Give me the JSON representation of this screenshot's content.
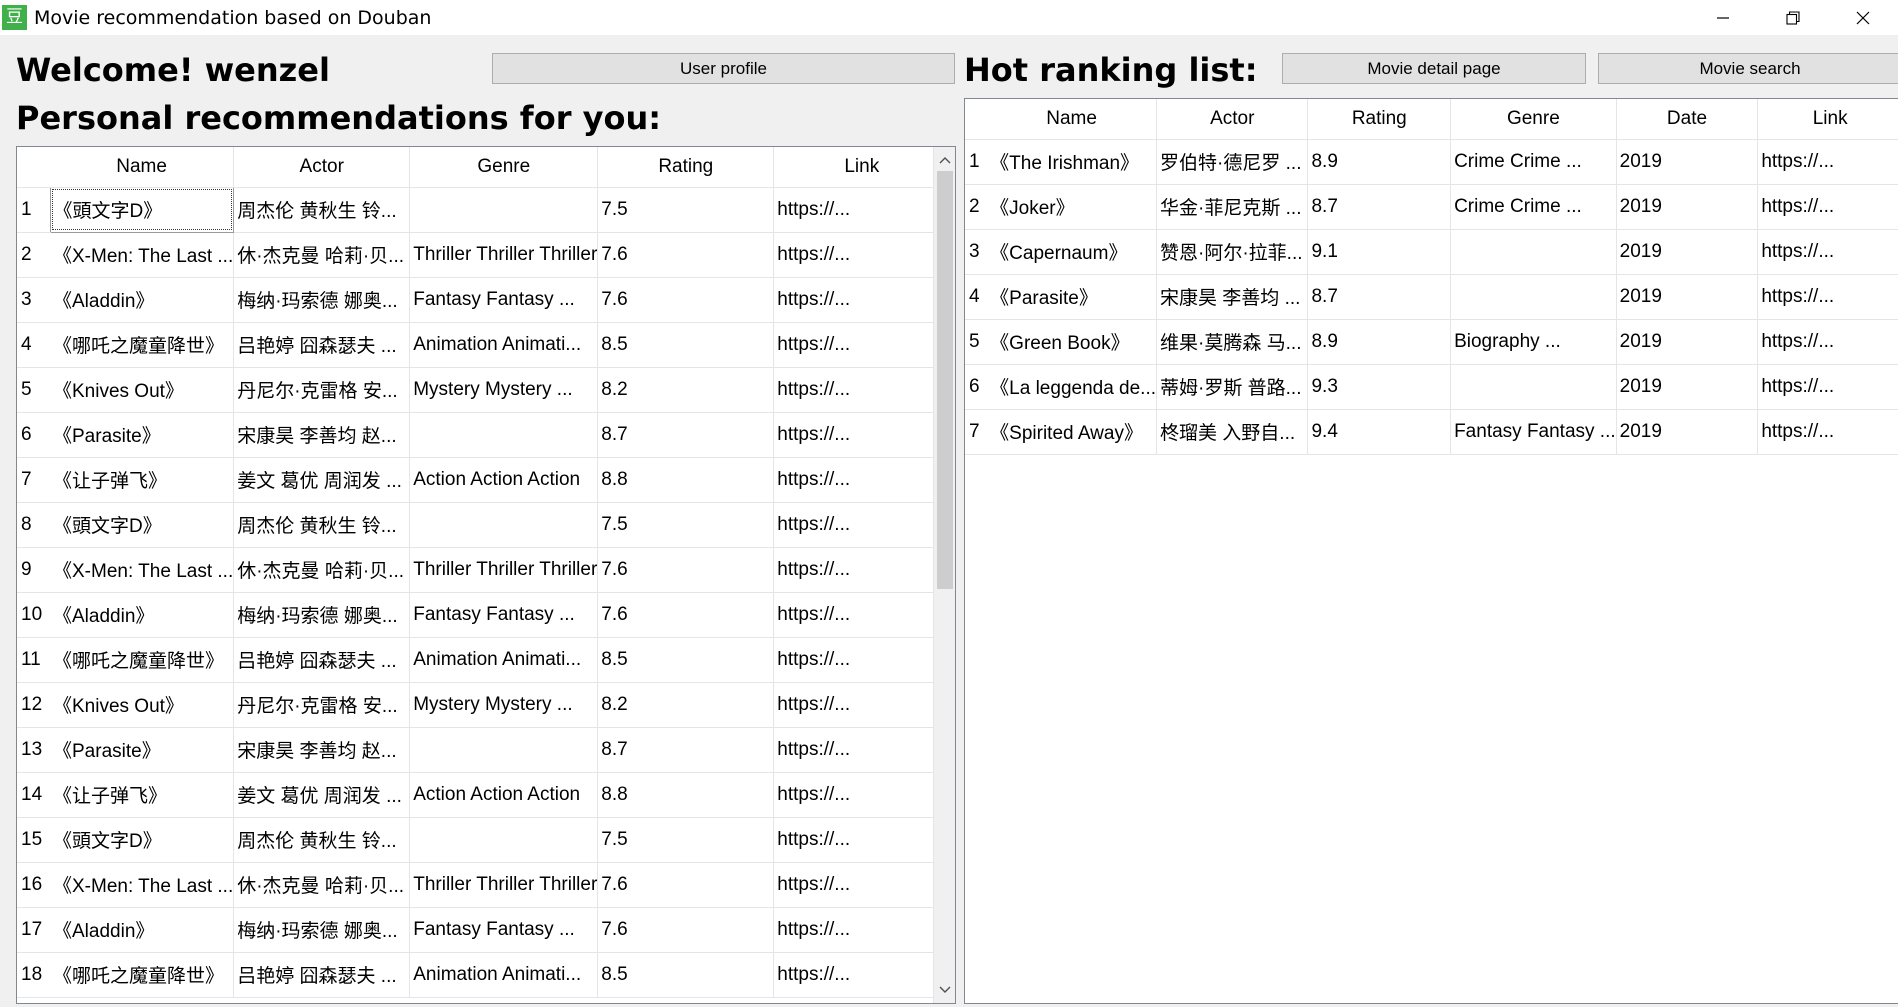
{
  "window": {
    "title": "Movie recommendation based on Douban",
    "icon_glyph": "豆",
    "icon_color": "#3fb04a"
  },
  "left": {
    "welcome": "Welcome! wenzel",
    "user_profile_button": "User profile",
    "personal_heading": "Personal recommendations for you:",
    "columns": [
      "Name",
      "Actor",
      "Genre",
      "Rating",
      "Link"
    ],
    "rows": [
      [
        "1",
        "《頭文字D》",
        "周杰伦  黄秋生  铃...",
        "",
        "7.5",
        "https://..."
      ],
      [
        "2",
        "《X-Men: The Last ...",
        "休·杰克曼  哈莉·贝...",
        "Thriller Thriller Thriller",
        "7.6",
        "https://..."
      ],
      [
        "3",
        "《Aladdin》",
        "梅纳·玛索德  娜奥...",
        "Fantasy Fantasy ...",
        "7.6",
        "https://..."
      ],
      [
        "4",
        "《哪吒之魔童降世》",
        "吕艳婷  囧森瑟夫  ...",
        "Animation Animati...",
        "8.5",
        "https://..."
      ],
      [
        "5",
        "《Knives Out》",
        "丹尼尔·克雷格  安...",
        "Mystery Mystery ...",
        "8.2",
        "https://..."
      ],
      [
        "6",
        "《Parasite》",
        "宋康昊  李善均  赵...",
        "",
        "8.7",
        "https://..."
      ],
      [
        "7",
        "《让子弹飞》",
        "姜文  葛优  周润发  ...",
        "Action Action Action",
        "8.8",
        "https://..."
      ],
      [
        "8",
        "《頭文字D》",
        "周杰伦  黄秋生  铃...",
        "",
        "7.5",
        "https://..."
      ],
      [
        "9",
        "《X-Men: The Last ...",
        "休·杰克曼  哈莉·贝...",
        "Thriller Thriller Thriller",
        "7.6",
        "https://..."
      ],
      [
        "10",
        "《Aladdin》",
        "梅纳·玛索德  娜奥...",
        "Fantasy Fantasy ...",
        "7.6",
        "https://..."
      ],
      [
        "11",
        "《哪吒之魔童降世》",
        "吕艳婷  囧森瑟夫  ...",
        "Animation Animati...",
        "8.5",
        "https://..."
      ],
      [
        "12",
        "《Knives Out》",
        "丹尼尔·克雷格  安...",
        "Mystery Mystery ...",
        "8.2",
        "https://..."
      ],
      [
        "13",
        "《Parasite》",
        "宋康昊  李善均  赵...",
        "",
        "8.7",
        "https://..."
      ],
      [
        "14",
        "《让子弹飞》",
        "姜文  葛优  周润发  ...",
        "Action Action Action",
        "8.8",
        "https://..."
      ],
      [
        "15",
        "《頭文字D》",
        "周杰伦  黄秋生  铃...",
        "",
        "7.5",
        "https://..."
      ],
      [
        "16",
        "《X-Men: The Last ...",
        "休·杰克曼  哈莉·贝...",
        "Thriller Thriller Thriller",
        "7.6",
        "https://..."
      ],
      [
        "17",
        "《Aladdin》",
        "梅纳·玛索德  娜奥...",
        "Fantasy Fantasy ...",
        "7.6",
        "https://..."
      ],
      [
        "18",
        "《哪吒之魔童降世》",
        "吕艳婷  囧森瑟夫  ...",
        "Animation Animati...",
        "8.5",
        "https://..."
      ]
    ]
  },
  "right": {
    "hot_heading": "Hot ranking list:",
    "detail_button": "Movie detail page",
    "search_button": "Movie search",
    "columns": [
      "Name",
      "Actor",
      "Rating",
      "Genre",
      "Date",
      "Link"
    ],
    "rows": [
      [
        "1",
        "《The Irishman》",
        "罗伯特·德尼罗  ...",
        "8.9",
        "Crime Crime ...",
        "2019",
        "https://..."
      ],
      [
        "2",
        "《Joker》",
        "华金·菲尼克斯  ...",
        "8.7",
        "Crime Crime ...",
        "2019",
        "https://..."
      ],
      [
        "3",
        "《Capernaum》",
        "赞恩·阿尔·拉菲...",
        "9.1",
        "",
        "2019",
        "https://..."
      ],
      [
        "4",
        "《Parasite》",
        "宋康昊  李善均  ...",
        "8.7",
        "",
        "2019",
        "https://..."
      ],
      [
        "5",
        "《Green Book》",
        "维果·莫腾森  马...",
        "8.9",
        "Biography ...",
        "2019",
        "https://..."
      ],
      [
        "6",
        "《La leggenda de...",
        "蒂姆·罗斯  普路...",
        "9.3",
        "",
        "2019",
        "https://..."
      ],
      [
        "7",
        "《Spirited Away》",
        "柊瑠美  入野自...",
        "9.4",
        "Fantasy Fantasy ...",
        "2019",
        "https://..."
      ]
    ]
  }
}
